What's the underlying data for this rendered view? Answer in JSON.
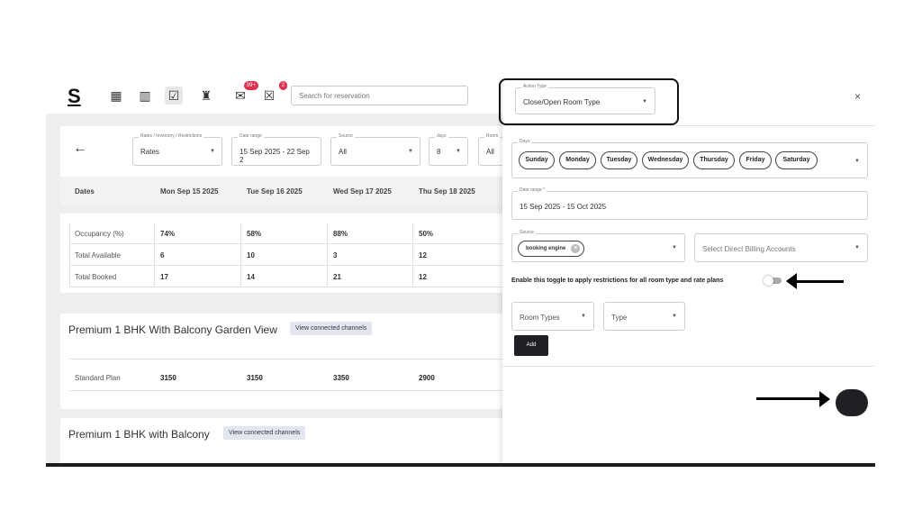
{
  "app": {
    "logo": "S",
    "search_placeholder": "Search for reservation",
    "badges": {
      "messages": "99+",
      "notifications": "2"
    }
  },
  "filters": {
    "rates": {
      "label": "Rates / Inventory / Restrictions",
      "value": "Rates"
    },
    "date_range": {
      "label": "Date range",
      "value": "15 Sep 2025 - 22 Sep 2"
    },
    "source": {
      "label": "Source",
      "value": "All"
    },
    "days": {
      "label": "days",
      "value": "8"
    },
    "room": {
      "label": "Room",
      "value": "All"
    }
  },
  "grid": {
    "headers": [
      "Dates",
      "Mon Sep 15 2025",
      "Tue Sep 16 2025",
      "Wed Sep 17 2025",
      "Thu Sep 18 2025"
    ],
    "stats": [
      {
        "name": "Occupancy (%)",
        "values": [
          "74%",
          "58%",
          "88%",
          "50%"
        ]
      },
      {
        "name": "Total Available",
        "values": [
          "6",
          "10",
          "3",
          "12"
        ]
      },
      {
        "name": "Total Booked",
        "values": [
          "17",
          "14",
          "21",
          "12"
        ]
      }
    ]
  },
  "rooms": [
    {
      "title": "Premium 1 BHK With Balcony Garden View",
      "channels_label": "View connected channels",
      "plan": {
        "name": "Standard Plan",
        "values": [
          "3150",
          "3150",
          "3350",
          "2900"
        ]
      }
    },
    {
      "title": "Premium 1 BHK with Balcony",
      "channels_label": "View connected channels"
    }
  ],
  "drawer": {
    "action_type": {
      "label": "Action Type",
      "value": "Close/Open Room Type"
    },
    "days": {
      "label": "Days",
      "chips": [
        "Sunday",
        "Monday",
        "Tuesday",
        "Wednesday",
        "Thursday",
        "Friday",
        "Saturday"
      ]
    },
    "date_range": {
      "label": "Date range *",
      "value": "15 Sep 2025 - 15 Oct 2025"
    },
    "source": {
      "label": "Source",
      "chip": "booking engine"
    },
    "billing_placeholder": "Select Direct Billing Accounts",
    "toggle_text": "Enable this toggle to apply restrictions for all room type and rate plans",
    "toggle_on": false,
    "room_types_placeholder": "Room Types",
    "type_placeholder": "Type",
    "add_label": "Add",
    "close_glyph": "×"
  }
}
